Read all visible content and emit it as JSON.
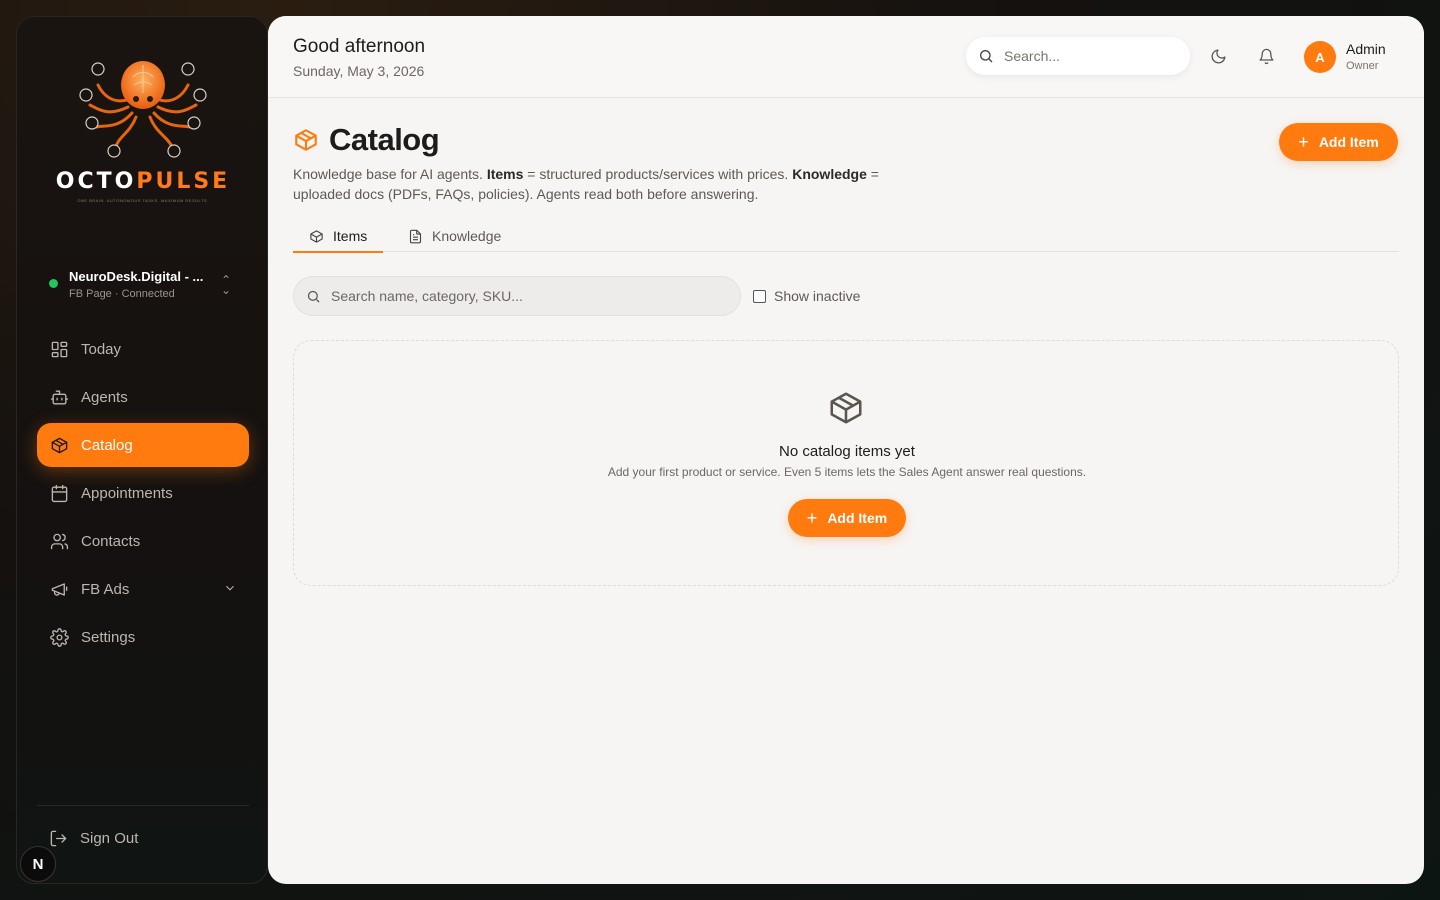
{
  "brand": {
    "name_prefix": "OCTO",
    "name_suffix": "PULSE",
    "tagline": "ONE BRAIN. AUTONOMOUS TASKS. MAXIMUM RESULTS."
  },
  "page_switcher": {
    "name": "NeuroDesk.Digital - ...",
    "subtitle": "FB Page · Connected"
  },
  "sidebar": {
    "items": [
      {
        "label": "Today",
        "icon": "dashboard-icon"
      },
      {
        "label": "Agents",
        "icon": "bot-icon"
      },
      {
        "label": "Catalog",
        "icon": "package-icon",
        "active": true
      },
      {
        "label": "Appointments",
        "icon": "calendar-icon"
      },
      {
        "label": "Contacts",
        "icon": "users-icon"
      },
      {
        "label": "FB Ads",
        "icon": "megaphone-icon",
        "expandable": true
      },
      {
        "label": "Settings",
        "icon": "gear-icon"
      }
    ],
    "signout_label": "Sign Out",
    "badge_letter": "N"
  },
  "header": {
    "greeting": "Good afternoon",
    "date": "Sunday, May 3, 2026",
    "search_placeholder": "Search...",
    "user": {
      "initial": "A",
      "name": "Admin",
      "role": "Owner"
    }
  },
  "catalog": {
    "title": "Catalog",
    "desc_1": "Knowledge base for AI agents. ",
    "desc_items": "Items",
    "desc_2": " = structured products/services with prices. ",
    "desc_knowledge": "Knowledge",
    "desc_3": " = uploaded docs (PDFs, FAQs, policies). Agents read both before answering.",
    "add_button": "Add Item",
    "tabs": [
      {
        "label": "Items",
        "active": true
      },
      {
        "label": "Knowledge"
      }
    ],
    "search_placeholder": "Search name, category, SKU...",
    "show_inactive_label": "Show inactive",
    "show_inactive_checked": false,
    "empty": {
      "title": "No catalog items yet",
      "subtitle": "Add your first product or service. Even 5 items lets the Sales Agent answer real questions.",
      "button": "Add Item"
    }
  },
  "colors": {
    "accent": "#ff7a0f",
    "status_connected": "#22c55e"
  }
}
